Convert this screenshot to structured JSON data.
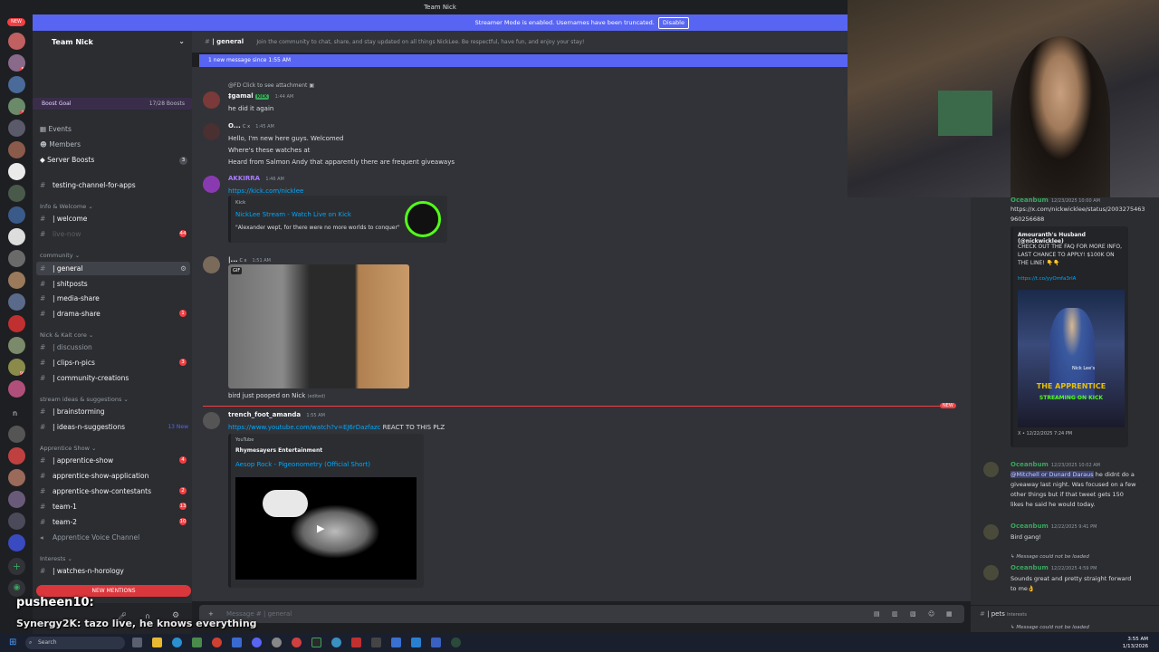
{
  "window": {
    "server_title": "Team Nick",
    "streamer_banner": "Streamer Mode is enabled. Usernames have been truncated.",
    "disable_button": "Disable"
  },
  "server_rail": {
    "new_badge": "NEW",
    "icons": [
      "server-1",
      "server-2",
      "server-3",
      "server-4",
      "server-5",
      "server-6",
      "server-7",
      "server-8",
      "server-9",
      "server-10",
      "server-11",
      "server-12",
      "server-13",
      "server-14",
      "server-15",
      "server-16",
      "server-17",
      "server-18",
      "server-19",
      "server-20",
      "server-21",
      "server-22",
      "server-23",
      "server-24",
      "server-25",
      "server-26",
      "server-27",
      "server-28",
      "server-29",
      "server-30",
      "server-31",
      "server-32"
    ],
    "letter_n": "n"
  },
  "sidebar": {
    "server_name": "Team Nick",
    "boost_goal_label": "Boost Goal",
    "boost_count": "17/28 Boosts",
    "nav": [
      "Events",
      "Members",
      "Server Boosts"
    ],
    "server_boosts_badge": "3",
    "channels": [
      {
        "name": "testing-channel-for-apps",
        "type": "text"
      },
      {
        "category": "Info & Welcome"
      },
      {
        "name": "| welcome",
        "type": "text",
        "unread": true
      },
      {
        "name": "live-now",
        "type": "text",
        "muted": true,
        "badge": "44"
      },
      {
        "category": "community"
      },
      {
        "name": "| general",
        "type": "text",
        "active": true
      },
      {
        "name": "| shitposts",
        "type": "text",
        "unread": true
      },
      {
        "name": "| media-share",
        "type": "text",
        "unread": true
      },
      {
        "name": "| drama-share",
        "type": "text",
        "unread": true,
        "badge": "1"
      },
      {
        "category": "Nick & Kait core"
      },
      {
        "name": "| discussion",
        "type": "text"
      },
      {
        "name": "| clips-n-pics",
        "type": "text",
        "unread": true,
        "badge": "3"
      },
      {
        "name": "| community-creations",
        "type": "text",
        "unread": true
      },
      {
        "category": "stream ideas & suggestions"
      },
      {
        "name": "| brainstorming",
        "type": "text",
        "unread": true
      },
      {
        "name": "| ideas-n-suggestions",
        "type": "text",
        "unread": true,
        "new": "13 New"
      },
      {
        "category": "Apprentice Show"
      },
      {
        "name": "| apprentice-show",
        "type": "text",
        "unread": true,
        "badge": "4"
      },
      {
        "name": "apprentice-show-application",
        "type": "text",
        "unread": true
      },
      {
        "name": "apprentice-show-contestants",
        "type": "text",
        "unread": true,
        "badge": "2"
      },
      {
        "name": "team-1",
        "type": "text",
        "unread": true,
        "badge": "13"
      },
      {
        "name": "team-2",
        "type": "text",
        "unread": true,
        "badge": "10"
      },
      {
        "name": "Apprentice Voice Channel",
        "type": "voice"
      },
      {
        "category": "Interests"
      },
      {
        "name": "| watches-n-horology",
        "type": "text",
        "unread": true
      }
    ],
    "new_mentions": "NEW MENTIONS",
    "user_status": "Online"
  },
  "channel_header": {
    "name": "| general",
    "description": "Join the community to chat, share, and stay updated on all things NickLee. Be respectful, have fun, and enjoy your stay!"
  },
  "new_message_bar": "1 new message since 1:55 AM",
  "messages": [
    {
      "reply": "@FD Click to see attachment",
      "user": "‡gamal",
      "tag": "KICK",
      "time": "1:44 AM",
      "text": "he did it again"
    },
    {
      "user": "O...",
      "tag": "C x",
      "time": "1:45 AM",
      "lines": [
        "Hello, I'm new here guys. Welcomed",
        "Where's these watches at",
        "Heard from Salmon Andy that apparently there are frequent giveaways"
      ]
    },
    {
      "user": "AKKIRRA",
      "time": "1:46 AM",
      "link": "https://kick.com/nicklee",
      "embed_site": "Kick",
      "embed_title": "NickLee Stream - Watch Live on Kick",
      "embed_desc": "\"Alexander wept, for there were no more worlds to conquer\""
    },
    {
      "user": "|...",
      "tag": "C x",
      "time": "1:51 AM",
      "gif_label": "GIF",
      "caption": "bird just pooped on Nick",
      "edited": "(edited)"
    },
    {
      "user": "trench_foot_amanda",
      "time": "1:55 AM",
      "link": "https://www.youtube.com/watch?v=EJ6rDazfazc",
      "after_link": " REACT TO THIS PLZ",
      "embed_site": "YouTube",
      "embed_author": "Rhymesayers Entertainment",
      "embed_title": "Aesop Rock - Pigeonometry (Official Short)"
    }
  ],
  "new_divider": "NEW",
  "composer": {
    "placeholder": "Message #",
    "channel": "| general"
  },
  "right_panel": {
    "posts": [
      {
        "user": "Oceanbum",
        "time": "12/23/2025 10:00 AM",
        "link": "https://x.com/nickwicklee/status/2003275463960256688"
      },
      {
        "embed_author": "Amouranth's Husband (@nickwicklee)",
        "embed_text": "CHECK OUT THE FAQ FOR MORE INFO, LAST CHANCE TO APPLY! $100K ON THE LINE! 👇👇",
        "embed_link": "https://t.co/yyOmfa3rlA",
        "poster_top": "Nick Lee's",
        "poster_title": "THE APPRENTICE",
        "poster_sub": "STREAMING ON KICK",
        "footer": "X • 12/22/2025 7:24 PM"
      },
      {
        "user": "Oceanbum",
        "time": "12/23/2025 10:02 AM",
        "mention": "@Mitchell or Dunard Daraus",
        "text": "he didnt do a giveaway last night. Was focused on a few other things but if that tweet gets 150 likes he said he would today."
      },
      {
        "user": "Oceanbum",
        "time": "12/22/2025 9:41 PM",
        "text": "Bird gang!"
      },
      {
        "note": "Message could not be loaded"
      },
      {
        "user": "Oceanbum",
        "time": "12/22/2025 4:59 PM",
        "text": "Sounds great and pretty straight forward to me👌"
      }
    ],
    "pets_channel": "| pets",
    "pets_category": "Interests",
    "bottom_note": "Message could not be loaded"
  },
  "overlay": {
    "line1": "pusheen10:",
    "line2": "Synergy2K: tazo live, he knows everything"
  },
  "taskbar": {
    "search": "Search",
    "time": "3:55 AM",
    "date": "1/13/2026"
  }
}
